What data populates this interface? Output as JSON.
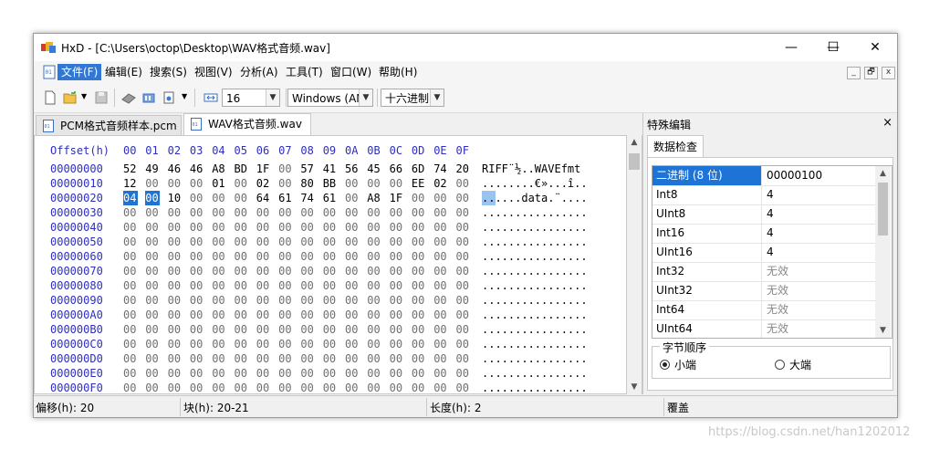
{
  "window": {
    "title": "HxD - [C:\\Users\\octop\\Desktop\\WAV格式音频.wav]",
    "minimize": "—",
    "maximize": "☐",
    "close": "✕"
  },
  "menu": {
    "items": [
      "文件(F)",
      "编辑(E)",
      "搜索(S)",
      "视图(V)",
      "分析(A)",
      "工具(T)",
      "窗口(W)",
      "帮助(H)"
    ],
    "mdi": [
      "_",
      "🗗",
      "x"
    ]
  },
  "toolbar": {
    "bytes_per_row": "16",
    "charset": "Windows (AN",
    "offset_base": "十六进制"
  },
  "tabs": [
    {
      "label": "PCM格式音频样本.pcm",
      "active": false
    },
    {
      "label": "WAV格式音频.wav",
      "active": true
    }
  ],
  "hex": {
    "header_label": "Offset(h)",
    "columns": [
      "00",
      "01",
      "02",
      "03",
      "04",
      "05",
      "06",
      "07",
      "08",
      "09",
      "0A",
      "0B",
      "0C",
      "0D",
      "0E",
      "0F"
    ],
    "rows": [
      {
        "offset": "00000000",
        "bytes": [
          "52",
          "49",
          "46",
          "46",
          "A8",
          "BD",
          "1F",
          "00",
          "57",
          "41",
          "56",
          "45",
          "66",
          "6D",
          "74",
          "20"
        ],
        "ascii": "RIFF¨½..WAVEfmt "
      },
      {
        "offset": "00000010",
        "bytes": [
          "12",
          "00",
          "00",
          "00",
          "01",
          "00",
          "02",
          "00",
          "80",
          "BB",
          "00",
          "00",
          "00",
          "EE",
          "02",
          "00"
        ],
        "ascii": "........€»...î.."
      },
      {
        "offset": "00000020",
        "bytes": [
          "04",
          "00",
          "10",
          "00",
          "00",
          "00",
          "64",
          "61",
          "74",
          "61",
          "00",
          "A8",
          "1F",
          "00",
          "00",
          "00"
        ],
        "ascii": "......data.¨...."
      },
      {
        "offset": "00000030",
        "bytes": [
          "00",
          "00",
          "00",
          "00",
          "00",
          "00",
          "00",
          "00",
          "00",
          "00",
          "00",
          "00",
          "00",
          "00",
          "00",
          "00"
        ],
        "ascii": "................"
      },
      {
        "offset": "00000040",
        "bytes": [
          "00",
          "00",
          "00",
          "00",
          "00",
          "00",
          "00",
          "00",
          "00",
          "00",
          "00",
          "00",
          "00",
          "00",
          "00",
          "00"
        ],
        "ascii": "................"
      },
      {
        "offset": "00000050",
        "bytes": [
          "00",
          "00",
          "00",
          "00",
          "00",
          "00",
          "00",
          "00",
          "00",
          "00",
          "00",
          "00",
          "00",
          "00",
          "00",
          "00"
        ],
        "ascii": "................"
      },
      {
        "offset": "00000060",
        "bytes": [
          "00",
          "00",
          "00",
          "00",
          "00",
          "00",
          "00",
          "00",
          "00",
          "00",
          "00",
          "00",
          "00",
          "00",
          "00",
          "00"
        ],
        "ascii": "................"
      },
      {
        "offset": "00000070",
        "bytes": [
          "00",
          "00",
          "00",
          "00",
          "00",
          "00",
          "00",
          "00",
          "00",
          "00",
          "00",
          "00",
          "00",
          "00",
          "00",
          "00"
        ],
        "ascii": "................"
      },
      {
        "offset": "00000080",
        "bytes": [
          "00",
          "00",
          "00",
          "00",
          "00",
          "00",
          "00",
          "00",
          "00",
          "00",
          "00",
          "00",
          "00",
          "00",
          "00",
          "00"
        ],
        "ascii": "................"
      },
      {
        "offset": "00000090",
        "bytes": [
          "00",
          "00",
          "00",
          "00",
          "00",
          "00",
          "00",
          "00",
          "00",
          "00",
          "00",
          "00",
          "00",
          "00",
          "00",
          "00"
        ],
        "ascii": "................"
      },
      {
        "offset": "000000A0",
        "bytes": [
          "00",
          "00",
          "00",
          "00",
          "00",
          "00",
          "00",
          "00",
          "00",
          "00",
          "00",
          "00",
          "00",
          "00",
          "00",
          "00"
        ],
        "ascii": "................"
      },
      {
        "offset": "000000B0",
        "bytes": [
          "00",
          "00",
          "00",
          "00",
          "00",
          "00",
          "00",
          "00",
          "00",
          "00",
          "00",
          "00",
          "00",
          "00",
          "00",
          "00"
        ],
        "ascii": "................"
      },
      {
        "offset": "000000C0",
        "bytes": [
          "00",
          "00",
          "00",
          "00",
          "00",
          "00",
          "00",
          "00",
          "00",
          "00",
          "00",
          "00",
          "00",
          "00",
          "00",
          "00"
        ],
        "ascii": "................"
      },
      {
        "offset": "000000D0",
        "bytes": [
          "00",
          "00",
          "00",
          "00",
          "00",
          "00",
          "00",
          "00",
          "00",
          "00",
          "00",
          "00",
          "00",
          "00",
          "00",
          "00"
        ],
        "ascii": "................"
      },
      {
        "offset": "000000E0",
        "bytes": [
          "00",
          "00",
          "00",
          "00",
          "00",
          "00",
          "00",
          "00",
          "00",
          "00",
          "00",
          "00",
          "00",
          "00",
          "00",
          "00"
        ],
        "ascii": "................"
      },
      {
        "offset": "000000F0",
        "bytes": [
          "00",
          "00",
          "00",
          "00",
          "00",
          "00",
          "00",
          "00",
          "00",
          "00",
          "00",
          "00",
          "00",
          "00",
          "00",
          "00"
        ],
        "ascii": "................"
      }
    ],
    "selected_row": 2,
    "selected_cols": [
      0,
      1
    ]
  },
  "side_panel": {
    "title": "特殊编辑",
    "close": "×",
    "tab": "数据检查",
    "rows": [
      {
        "name": "二进制 (8 位)",
        "value": "00000100",
        "selected": true,
        "na": false
      },
      {
        "name": "Int8",
        "value": "4",
        "selected": false,
        "na": false
      },
      {
        "name": "UInt8",
        "value": "4",
        "selected": false,
        "na": false
      },
      {
        "name": "Int16",
        "value": "4",
        "selected": false,
        "na": false
      },
      {
        "name": "UInt16",
        "value": "4",
        "selected": false,
        "na": false
      },
      {
        "name": "Int32",
        "value": "无效",
        "selected": false,
        "na": true
      },
      {
        "name": "UInt32",
        "value": "无效",
        "selected": false,
        "na": true
      },
      {
        "name": "Int64",
        "value": "无效",
        "selected": false,
        "na": true
      },
      {
        "name": "UInt64",
        "value": "无效",
        "selected": false,
        "na": true
      }
    ],
    "byte_order": {
      "label": "字节顺序",
      "little": "小端",
      "big": "大端",
      "selected": "little"
    }
  },
  "status": {
    "offset": "偏移(h): 20",
    "block": "块(h): 20-21",
    "length": "长度(h): 2",
    "mode": "覆盖"
  },
  "watermark": "https://blog.csdn.net/han1202012",
  "colors": {
    "selection": "#1e73d7",
    "offset_text": "#2e2ebf",
    "menu_active": "#3377d6"
  }
}
